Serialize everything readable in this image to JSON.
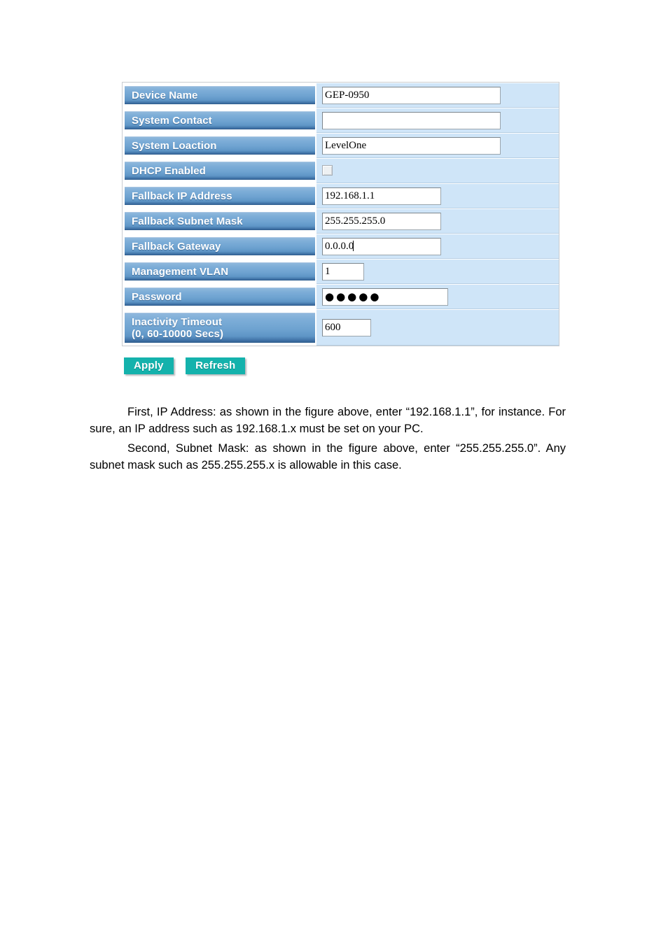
{
  "figure": {
    "rows": [
      {
        "label": "Device Name",
        "label_line2": "",
        "control": "text",
        "value": "GEP-0950",
        "width": "wide"
      },
      {
        "label": "System Contact",
        "label_line2": "",
        "control": "text",
        "value": "",
        "width": "wide"
      },
      {
        "label": "System Loaction",
        "label_line2": "",
        "control": "text",
        "value": "LevelOne",
        "width": "wide"
      },
      {
        "label": "DHCP Enabled",
        "label_line2": "",
        "control": "checkbox",
        "value": "",
        "checked": false
      },
      {
        "label": "Fallback IP Address",
        "label_line2": "",
        "control": "text",
        "value": "192.168.1.1",
        "width": "ip"
      },
      {
        "label": "Fallback Subnet Mask",
        "label_line2": "",
        "control": "text",
        "value": "255.255.255.0",
        "width": "ip"
      },
      {
        "label": "Fallback Gateway",
        "label_line2": "",
        "control": "text",
        "value": "0.0.0.0",
        "width": "ip",
        "caret": true
      },
      {
        "label": "Management VLAN",
        "label_line2": "",
        "control": "text",
        "value": "1",
        "width": "small"
      },
      {
        "label": "Password",
        "label_line2": "",
        "control": "password",
        "value": "●●●●●",
        "width": "pass"
      },
      {
        "label": "Inactivity Timeout",
        "label_line2": "(0, 60-10000 Secs)",
        "control": "text",
        "value": "600",
        "width": "num"
      }
    ],
    "buttons": {
      "apply": "Apply",
      "refresh": "Refresh"
    },
    "colors": {
      "label_blue": "#6da2d0",
      "value_blue": "#cfe5f8",
      "button_teal": "#14b2ac"
    }
  },
  "body_text": {
    "paragraph_first": "First, IP Address: as shown in the figure above, enter “192.168.1.1”, for instance. For sure, an IP address such as 192.168.1.x must be set on your PC.",
    "paragraph_second": "Second, Subnet Mask: as shown in the figure above, enter “255.255.255.0”. Any subnet mask such as 255.255.255.x is allowable in this case."
  }
}
